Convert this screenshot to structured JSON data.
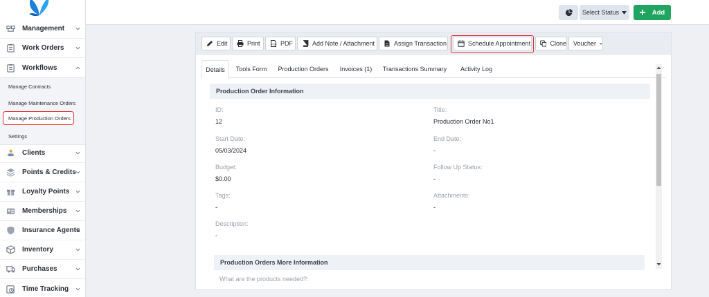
{
  "sidebar": {
    "items": [
      {
        "label": "Management",
        "icon": "management-icon"
      },
      {
        "label": "Work Orders",
        "icon": "clipboard-icon"
      },
      {
        "label": "Workflows",
        "icon": "clipboard-icon"
      }
    ],
    "workflows_sub": [
      {
        "label": "Manage Contracts"
      },
      {
        "label": "Manage Maintenance Orders"
      },
      {
        "label": "Manage Production Orders"
      },
      {
        "label": "Settings"
      }
    ],
    "items_after": [
      {
        "label": "Clients",
        "icon": "clients-icon"
      },
      {
        "label": "Points & Credits",
        "icon": "layers-icon"
      },
      {
        "label": "Loyalty Points",
        "icon": "gift-icon"
      },
      {
        "label": "Memberships",
        "icon": "id-card-icon"
      },
      {
        "label": "Insurance Agents",
        "icon": "shield-icon"
      },
      {
        "label": "Inventory",
        "icon": "box-icon"
      },
      {
        "label": "Purchases",
        "icon": "truck-icon"
      },
      {
        "label": "Time Tracking",
        "icon": "timer-icon"
      }
    ]
  },
  "topbar": {
    "select_status": "Select Status",
    "add_label": "Add"
  },
  "actions": [
    {
      "label": "Edit",
      "icon": "pencil-icon"
    },
    {
      "label": "Print",
      "icon": "printer-icon"
    },
    {
      "label": "PDF",
      "icon": "pdf-icon"
    },
    {
      "label": "Add Note / Attachment",
      "icon": "book-icon"
    },
    {
      "label": "Assign Transaction",
      "icon": "file-icon"
    },
    {
      "label": "Schedule Appointment",
      "icon": "calendar-icon"
    },
    {
      "label": "Clone",
      "icon": "clone-icon"
    },
    {
      "label": "Voucher",
      "icon": "caret-down-icon"
    }
  ],
  "tabs": [
    {
      "label": "Details"
    },
    {
      "label": "Tools Form"
    },
    {
      "label": "Production Orders"
    },
    {
      "label": "Invoices (1)"
    },
    {
      "label": "Transactions Summary"
    },
    {
      "label": "Activity Log"
    }
  ],
  "info": {
    "section_title": "Production Order Information",
    "id_label": "ID:",
    "id_value": "12",
    "title_label": "Title:",
    "title_value": "Production Order No1",
    "start_label": "Start Date:",
    "start_value": "05/03/2024",
    "end_label": "End Date:",
    "end_value": "-",
    "budget_label": "Budget:",
    "budget_value": "$0.00",
    "followup_label": "Follow Up Status:",
    "followup_value": "-",
    "tags_label": "Tags:",
    "tags_value": "-",
    "attachments_label": "Attachments:",
    "attachments_value": "-",
    "description_label": "Description:",
    "description_value": "-"
  },
  "more": {
    "section_title": "Production Orders More Information",
    "question": "What are the products needed?:"
  },
  "colors": {
    "accent_green": "#1fa55f",
    "highlight_red": "#e0303a"
  }
}
